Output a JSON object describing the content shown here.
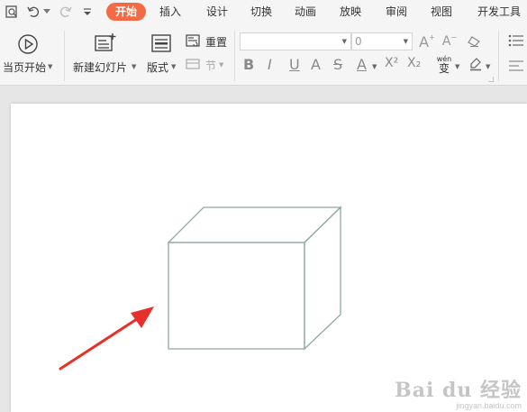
{
  "ribbon": {
    "tabs": [
      {
        "label": "开始",
        "active": true
      },
      {
        "label": "插入"
      },
      {
        "label": "设计"
      },
      {
        "label": "切换"
      },
      {
        "label": "动画"
      },
      {
        "label": "放映"
      },
      {
        "label": "审阅"
      },
      {
        "label": "视图"
      },
      {
        "label": "开发工具"
      }
    ],
    "active_color": "#f26b45",
    "quick_access_icons": [
      "print-preview-icon",
      "undo-icon",
      "redo-icon",
      "customize-dropdown-icon"
    ]
  },
  "toolbar": {
    "play_from_start_label": "当页开始",
    "new_slide_label": "新建幻灯片",
    "layout_label": "版式",
    "reset_label": "重置",
    "section_label": "节",
    "font_name_value": "",
    "font_size_value": "0",
    "bold_label": "B",
    "italic_label": "I",
    "underline_label": "U",
    "shadow_label": "A",
    "strikethrough_label": "S",
    "font_color_label": "A",
    "superscript_label": "X²",
    "subscript_label": "X₂",
    "pinyin_label": "wén",
    "pinyin_char": "变",
    "increase_font_label": "A",
    "decrease_font_label": "A"
  },
  "slide": {
    "shape": "cube",
    "shape_stroke": "#8fa8a0",
    "arrow_color": "#e8302a",
    "watermark_brand": "Bai du 经验",
    "watermark_url": "jingyan.baidu.com"
  }
}
